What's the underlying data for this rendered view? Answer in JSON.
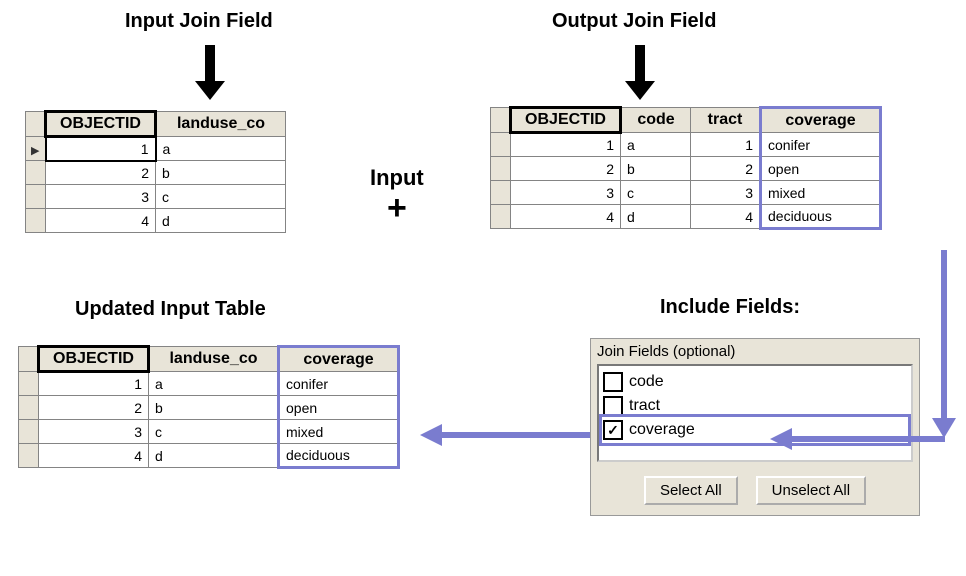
{
  "labels": {
    "input_join_field": "Input Join Field",
    "output_join_field": "Output Join Field",
    "input_word": "Input",
    "updated_input_table": "Updated Input Table",
    "include_fields": "Include Fields:"
  },
  "input_table": {
    "columns": [
      "OBJECTID",
      "landuse_co"
    ],
    "rows": [
      {
        "objectid": "1",
        "landuse_co": "a"
      },
      {
        "objectid": "2",
        "landuse_co": "b"
      },
      {
        "objectid": "3",
        "landuse_co": "c"
      },
      {
        "objectid": "4",
        "landuse_co": "d"
      }
    ]
  },
  "output_table": {
    "columns": [
      "OBJECTID",
      "code",
      "tract",
      "coverage"
    ],
    "rows": [
      {
        "objectid": "1",
        "code": "a",
        "tract": "1",
        "coverage": "conifer"
      },
      {
        "objectid": "2",
        "code": "b",
        "tract": "2",
        "coverage": "open"
      },
      {
        "objectid": "3",
        "code": "c",
        "tract": "3",
        "coverage": "mixed"
      },
      {
        "objectid": "4",
        "code": "d",
        "tract": "4",
        "coverage": "deciduous"
      }
    ]
  },
  "updated_table": {
    "columns": [
      "OBJECTID",
      "landuse_co",
      "coverage"
    ],
    "rows": [
      {
        "objectid": "1",
        "landuse_co": "a",
        "coverage": "conifer"
      },
      {
        "objectid": "2",
        "landuse_co": "b",
        "coverage": "open"
      },
      {
        "objectid": "3",
        "landuse_co": "c",
        "coverage": "mixed"
      },
      {
        "objectid": "4",
        "landuse_co": "d",
        "coverage": "deciduous"
      }
    ]
  },
  "join_panel": {
    "title": "Join Fields (optional)",
    "options": [
      {
        "label": "code",
        "checked": false
      },
      {
        "label": "tract",
        "checked": false
      },
      {
        "label": "coverage",
        "checked": true
      }
    ],
    "select_all": "Select All",
    "unselect_all": "Unselect All"
  }
}
